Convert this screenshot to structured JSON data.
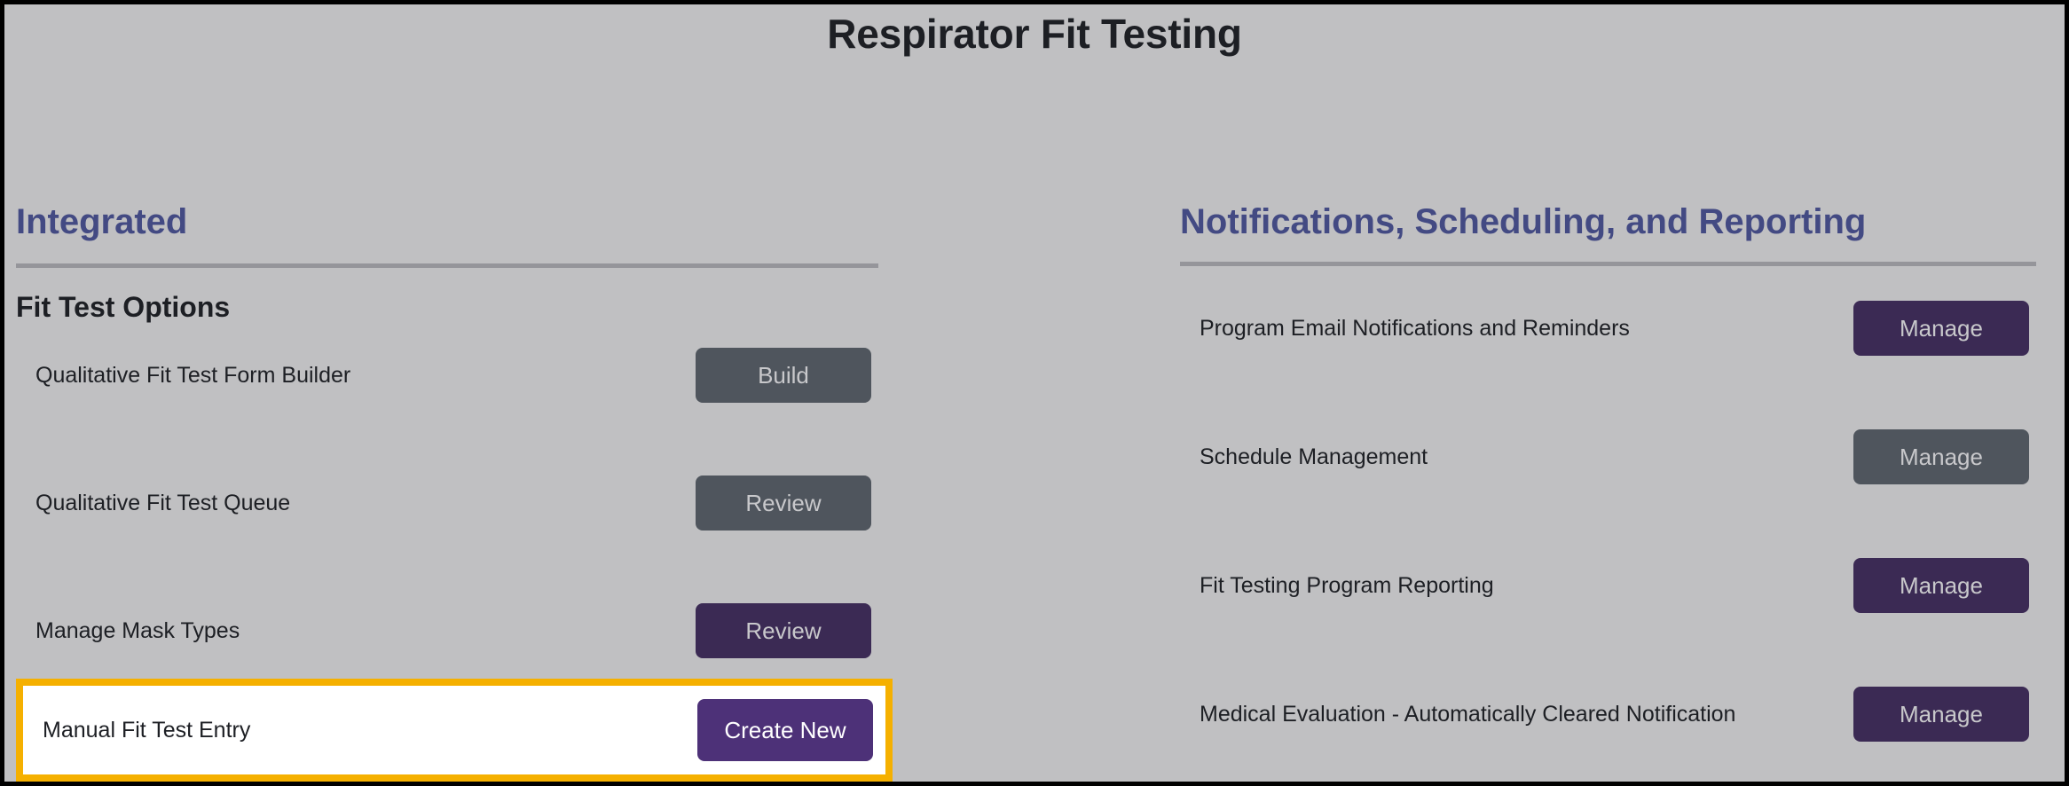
{
  "page": {
    "title": "Respirator Fit Testing",
    "background_color": "#c0c0c2",
    "frame_color": "#000000"
  },
  "colors": {
    "heading_accent": "#434a83",
    "button_gray": "#4f555d",
    "button_purple": "#3b2a54",
    "button_violet": "#4d3178",
    "highlight_border": "#f5b000",
    "rule": "#95959a",
    "text": "#1d1f24"
  },
  "left_column": {
    "heading": "Integrated",
    "subheading": "Fit Test Options",
    "rows": [
      {
        "label": "Qualitative Fit Test Form Builder",
        "button": "Build",
        "style": "gray"
      },
      {
        "label": "Qualitative Fit Test Queue",
        "button": "Review",
        "style": "gray"
      },
      {
        "label": "Manage Mask Types",
        "button": "Review",
        "style": "purple"
      }
    ],
    "highlighted_row": {
      "label": "Manual Fit Test Entry",
      "button": "Create New",
      "style": "violet",
      "highlighted": true
    }
  },
  "right_column": {
    "heading": "Notifications, Scheduling, and Reporting",
    "rows": [
      {
        "label": "Program Email Notifications and Reminders",
        "button": "Manage",
        "style": "purple"
      },
      {
        "label": "Schedule Management",
        "button": "Manage",
        "style": "gray"
      },
      {
        "label": "Fit Testing Program Reporting",
        "button": "Manage",
        "style": "purple"
      },
      {
        "label": "Medical Evaluation - Automatically Cleared Notification",
        "button": "Manage",
        "style": "purple"
      }
    ]
  }
}
